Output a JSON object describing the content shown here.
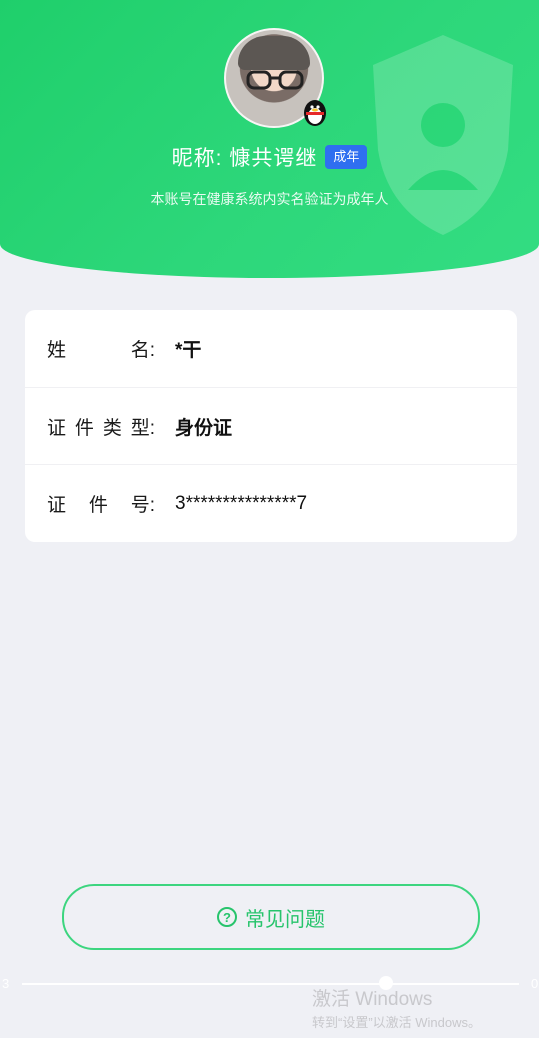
{
  "header": {
    "nickname": "昵称: 慷共谔继",
    "age_badge": "成年",
    "verify_note": "本账号在健康系统内实名验证为成年人"
  },
  "info": {
    "rows": [
      {
        "label_chars": [
          "姓",
          "名:"
        ],
        "value": "*干"
      },
      {
        "label_chars": [
          "证",
          "件",
          "类",
          "型:"
        ],
        "value": "身份证"
      },
      {
        "label_chars": [
          "证",
          "件",
          "号:"
        ],
        "value": "3***************7"
      }
    ]
  },
  "faq": {
    "icon": "question-circle-icon",
    "label": "常见问题"
  },
  "slider": {
    "left_label": "3",
    "right_label": "0"
  },
  "watermark": {
    "title": "激活 Windows",
    "subtitle": "转到“设置”以激活 Windows。"
  },
  "colors": {
    "header_green": "#2dd77a",
    "badge_blue": "#2f6ff0",
    "faq_green": "#27c46c",
    "page_bg": "#eff0f5"
  }
}
